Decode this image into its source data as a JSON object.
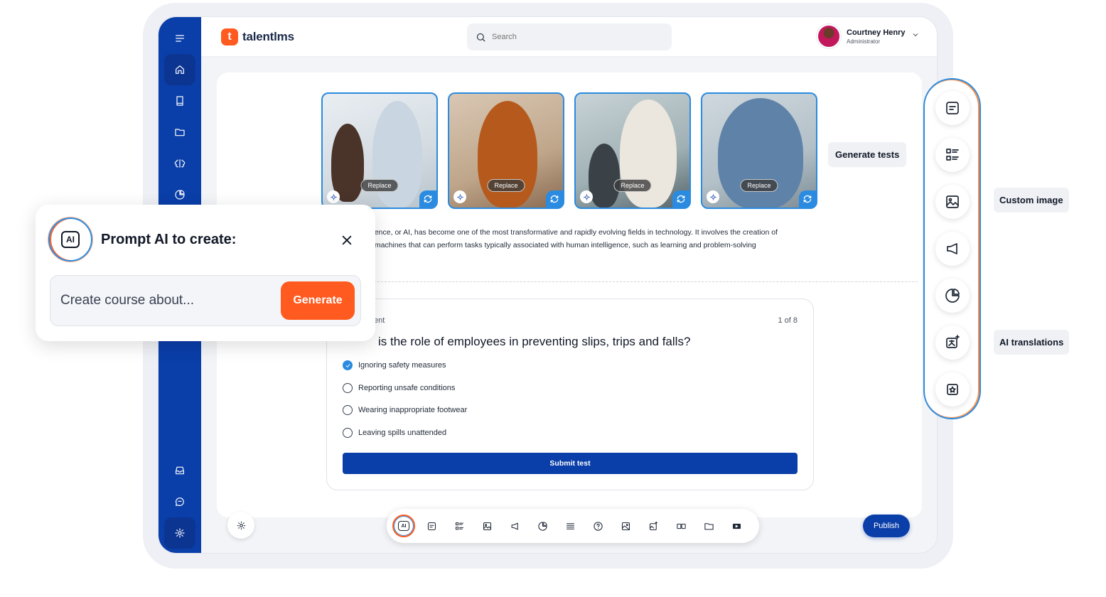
{
  "app": {
    "brand": "talentlms",
    "brand_letter": "t"
  },
  "header": {
    "search_placeholder": "Search",
    "user_name": "Courtney Henry",
    "user_role": "Administrator"
  },
  "photos": [
    {
      "replace_label": "Replace"
    },
    {
      "replace_label": "Replace"
    },
    {
      "replace_label": "Replace"
    },
    {
      "replace_label": "Replace"
    }
  ],
  "content": {
    "paragraph_line1": "gence, or AI, has become one of the most transformative and rapidly evolving fields in technology. It involves the creation of",
    "paragraph_line2": "t machines that can perform tasks typically associated with human intelligence, such as learning and problem-solving"
  },
  "quiz": {
    "label": "ent",
    "count": "1 of 8",
    "question": "is the role of employees in preventing slips, trips and falls?",
    "options": [
      {
        "label": "Ignoring safety measures",
        "checked": true
      },
      {
        "label": "Reporting unsafe conditions",
        "checked": false
      },
      {
        "label": "Wearing inappropriate footwear",
        "checked": false
      },
      {
        "label": "Leaving spills unattended",
        "checked": false
      }
    ],
    "submit_label": "Submit test"
  },
  "tooltips": {
    "generate_tests": "Generate tests",
    "custom_image": "Custom image",
    "ai_translations": "AI translations"
  },
  "toolbar": {
    "ai_label": "AI",
    "publish_label": "Publish"
  },
  "prompt": {
    "ai_label": "AI",
    "title": "Prompt AI to create:",
    "placeholder": "Create course about...",
    "generate_label": "Generate"
  },
  "colors": {
    "sidebar": "#0a3ea8",
    "accent": "#ff5a1f",
    "highlight": "#2a8be0"
  }
}
